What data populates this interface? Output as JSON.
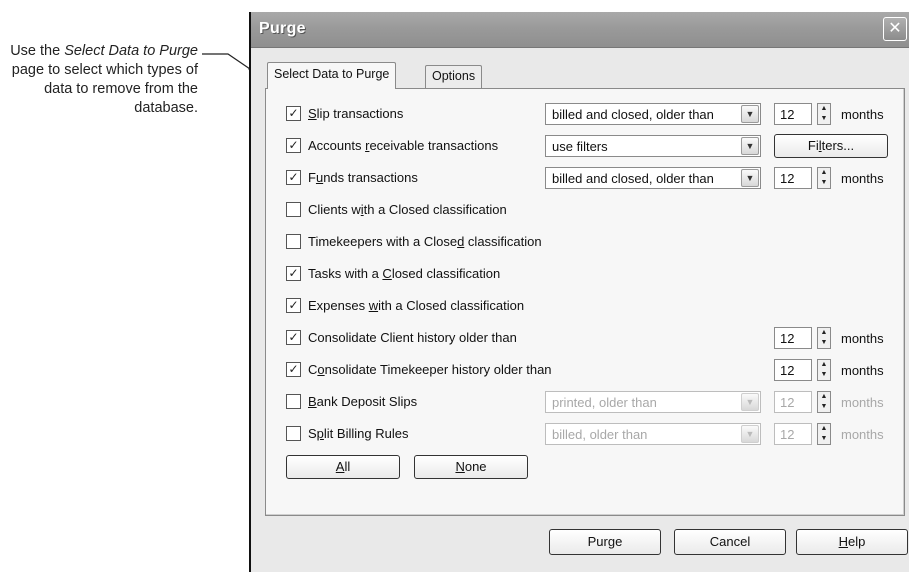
{
  "callout": {
    "prefix": "Use the ",
    "emph": "Select Data to Purge",
    "suffix": " page to select which types of data to remove from the database."
  },
  "window": {
    "title": "Purge",
    "close_glyph": "✕"
  },
  "tabs": [
    {
      "label": "Select Data to Purge",
      "active": true
    },
    {
      "label": "Options",
      "active": false
    }
  ],
  "rows": [
    {
      "pre": "",
      "u": "S",
      "post": "lip transactions",
      "checked": true
    },
    {
      "pre": "Accounts ",
      "u": "r",
      "post": "eceivable transactions",
      "checked": true
    },
    {
      "pre": "F",
      "u": "u",
      "post": "nds transactions",
      "checked": true
    },
    {
      "pre": "Clients w",
      "u": "i",
      "post": "th a Closed classification",
      "checked": false
    },
    {
      "pre": "Timekeepers with a Close",
      "u": "d",
      "post": " classification",
      "checked": false
    },
    {
      "pre": "Tasks with a ",
      "u": "C",
      "post": "losed classification",
      "checked": true
    },
    {
      "pre": "Expenses ",
      "u": "w",
      "post": "ith a Closed classification",
      "checked": true
    },
    {
      "pre": "Consolidate Client history older than",
      "u": "",
      "post": "",
      "checked": true
    },
    {
      "pre": "C",
      "u": "o",
      "post": "nsolidate Timekeeper history older than",
      "checked": true
    },
    {
      "pre": "",
      "u": "B",
      "post": "ank Deposit Slips",
      "checked": false
    },
    {
      "pre": "S",
      "u": "p",
      "post": "lit Billing Rules",
      "checked": false
    }
  ],
  "combos": {
    "slip": "billed and closed, older than",
    "ar": "use filters",
    "funds": "billed and closed, older than",
    "bank": "printed, older than",
    "split": "billed, older than"
  },
  "spins": {
    "slip": "12",
    "funds": "12",
    "client_hist": "12",
    "tk_hist": "12",
    "bank": "12",
    "split": "12"
  },
  "unit_label": "months",
  "check_glyph": "✓",
  "arrow_glyph": "▼",
  "buttons": {
    "filters": {
      "pre": "Fi",
      "u": "l",
      "post": "ters..."
    },
    "all": {
      "pre": "",
      "u": "A",
      "post": "ll"
    },
    "none": {
      "pre": "",
      "u": "N",
      "post": "one"
    },
    "purge": "Purge",
    "cancel": "Cancel",
    "help": {
      "pre": "",
      "u": "H",
      "post": "elp"
    }
  }
}
